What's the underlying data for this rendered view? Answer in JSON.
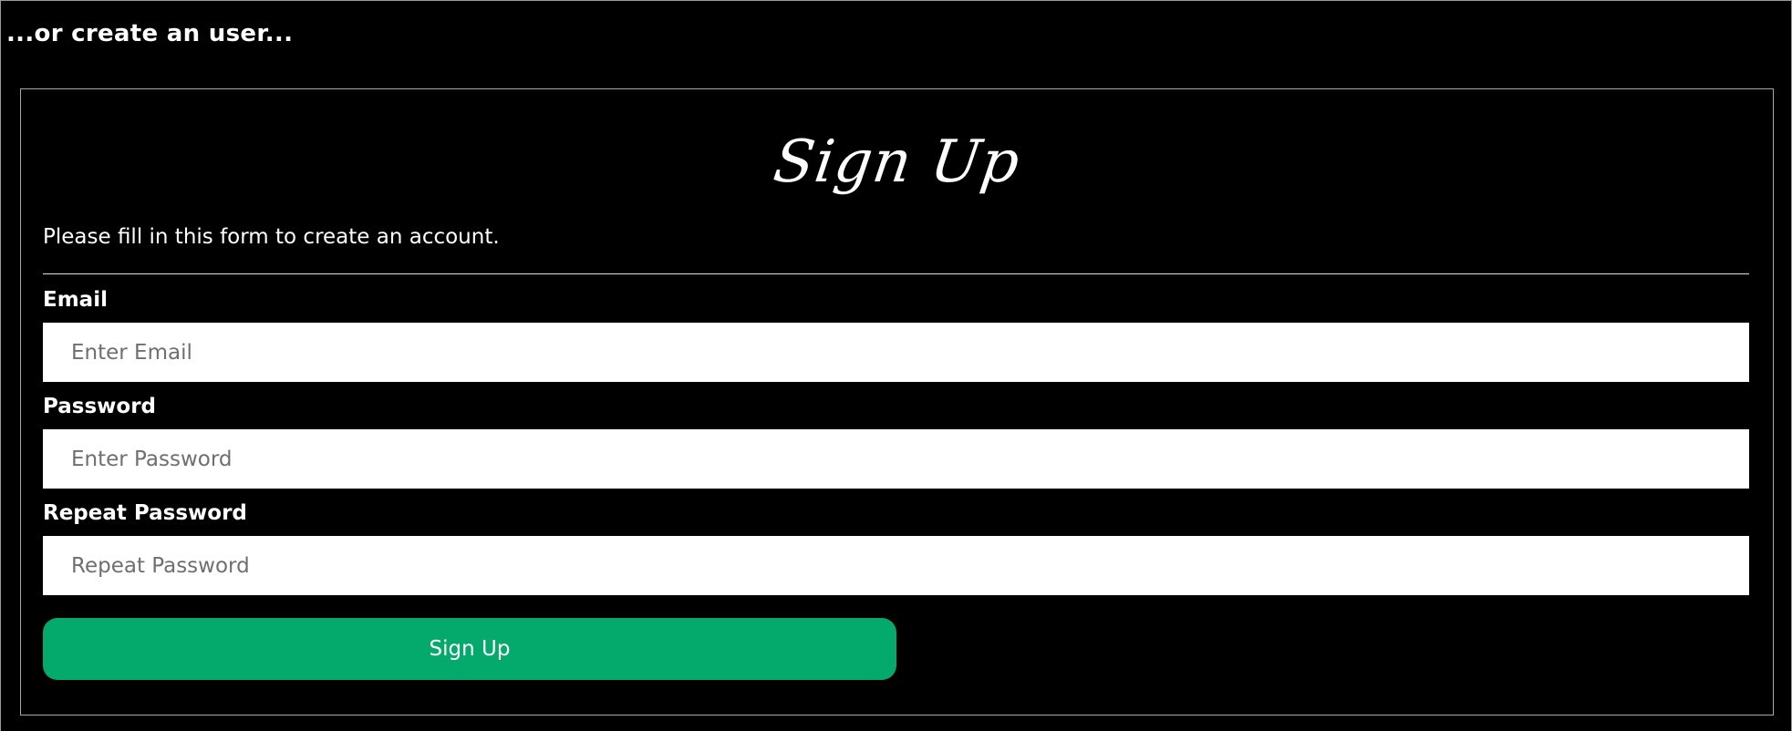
{
  "intro": {
    "heading": "...or create an user..."
  },
  "signup_form": {
    "title": "Sign Up",
    "subtitle": "Please fill in this form to create an account.",
    "fields": [
      {
        "label": "Email",
        "placeholder": "Enter Email",
        "value": ""
      },
      {
        "label": "Password",
        "placeholder": "Enter Password",
        "value": ""
      },
      {
        "label": "Repeat Password",
        "placeholder": "Repeat Password",
        "value": ""
      }
    ],
    "submit_label": "Sign Up"
  },
  "colors": {
    "background": "#000000",
    "text": "#ffffff",
    "button": "#04a96c",
    "input_background": "#ffffff",
    "border": "#a8a8a8"
  }
}
